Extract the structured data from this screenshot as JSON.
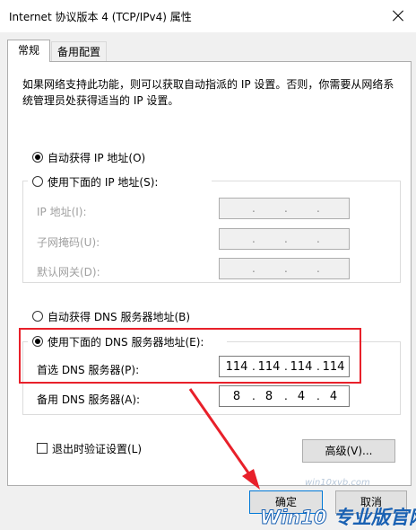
{
  "window": {
    "title": "Internet 协议版本 4 (TCP/IPv4) 属性"
  },
  "tabs": [
    {
      "label": "常规",
      "active": true
    },
    {
      "label": "备用配置",
      "active": false
    }
  ],
  "description": "如果网络支持此功能，则可以获取自动指派的 IP 设置。否则，你需要从网络系统管理员处获得适当的 IP 设置。",
  "ip_section": {
    "auto_label": "自动获得 IP 地址(O)",
    "auto_checked": true,
    "manual_label": "使用下面的 IP 地址(S):",
    "manual_checked": false,
    "fields": [
      {
        "label": "IP 地址(I):",
        "value": ""
      },
      {
        "label": "子网掩码(U):",
        "value": ""
      },
      {
        "label": "默认网关(D):",
        "value": ""
      }
    ],
    "separator": "."
  },
  "dns_section": {
    "auto_label": "自动获得 DNS 服务器地址(B)",
    "auto_checked": false,
    "manual_label": "使用下面的 DNS 服务器地址(E):",
    "manual_checked": true,
    "preferred": {
      "label": "首选 DNS 服务器(P):",
      "octets": [
        "114",
        "114",
        "114",
        "114"
      ]
    },
    "alternate": {
      "label": "备用 DNS 服务器(A):",
      "octets": [
        "8",
        "8",
        "4",
        "4"
      ]
    }
  },
  "validate_on_exit": {
    "label": "退出时验证设置(L)",
    "checked": false
  },
  "buttons": {
    "advanced": "高级(V)...",
    "ok": "确定",
    "cancel": "取消"
  },
  "watermark": {
    "url": "win10xvb.com",
    "brand_win10": "Win10",
    "brand_text": " 专业版官网"
  },
  "colors": {
    "highlight": "#e8202a",
    "arrow": "#e8202a",
    "watermark": "#1a61b3"
  }
}
